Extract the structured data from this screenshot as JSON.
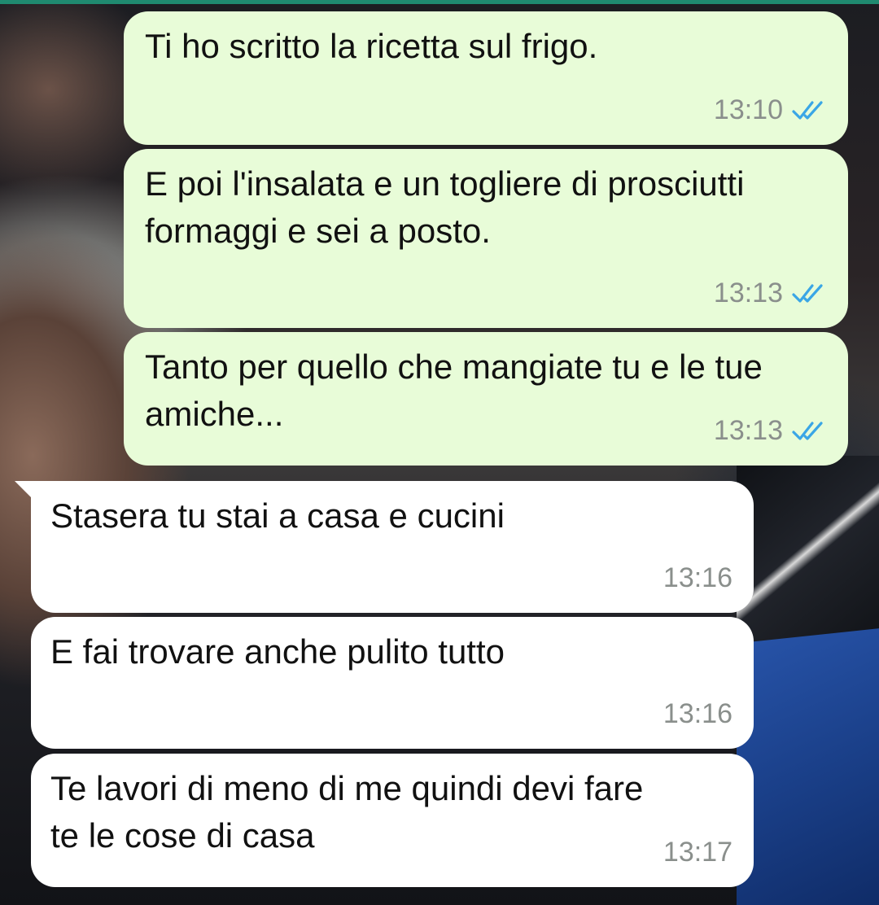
{
  "colors": {
    "outgoing_bubble": "#e8fcd8",
    "incoming_bubble": "#ffffff",
    "read_tick": "#3aa6e6",
    "timestamp": "#8a8f8c"
  },
  "messages": [
    {
      "direction": "outgoing",
      "text": "Ti ho scritto la ricetta sul frigo.",
      "time": "13:10",
      "status_icon": "double-check-read-icon"
    },
    {
      "direction": "outgoing",
      "text": "E poi l'insalata e un togliere di prosciutti formaggi e sei a posto.",
      "time": "13:13",
      "status_icon": "double-check-read-icon"
    },
    {
      "direction": "outgoing",
      "text": "Tanto per quello che mangiate tu e le tue amiche...",
      "time": "13:13",
      "status_icon": "double-check-read-icon"
    },
    {
      "direction": "incoming",
      "text": "Stasera tu stai a casa e cucini",
      "time": "13:16"
    },
    {
      "direction": "incoming",
      "text": "E fai trovare anche pulito tutto",
      "time": "13:16"
    },
    {
      "direction": "incoming",
      "text": "Te lavori di meno di me quindi devi fare te le cose di casa",
      "time": "13:17"
    }
  ]
}
